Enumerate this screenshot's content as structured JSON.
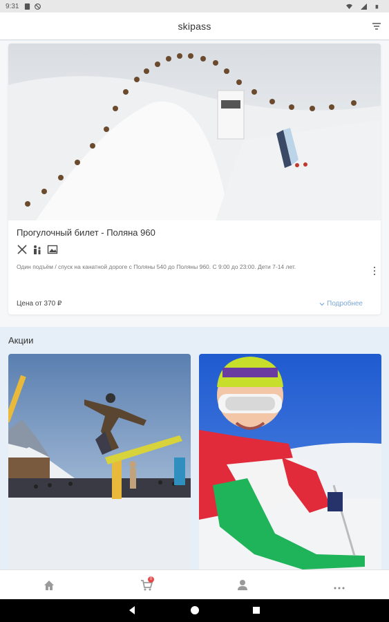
{
  "status_bar": {
    "time": "9:31"
  },
  "app_bar": {
    "title": "skipass",
    "filter_icon": "filter-icon"
  },
  "ticket_card": {
    "title": "Прогулочный билет - Поляна 960",
    "feature_icons": [
      "ski-lift-icon",
      "family-icon",
      "photo-icon"
    ],
    "description": "Один подъём / спуск на канатной дороге с Поляны 540 до Поляны 960. С 9:00 до 23:00. Дети 7-14 лет.",
    "price": "Цена от 370 ₽",
    "details_label": "Подробнее",
    "accent_color": "#7aa7d6"
  },
  "promotions": {
    "section_title": "Акции",
    "items": [
      {
        "image": "snowboarder-jump-photo"
      },
      {
        "image": "child-skier-photo"
      }
    ]
  },
  "bottom_nav": {
    "items": [
      "home-icon",
      "cart-icon",
      "profile-icon",
      "more-icon"
    ],
    "cart_badge": "0",
    "badge_color": "#e84848"
  },
  "system_nav": [
    "back-button",
    "home-button",
    "recents-button"
  ]
}
